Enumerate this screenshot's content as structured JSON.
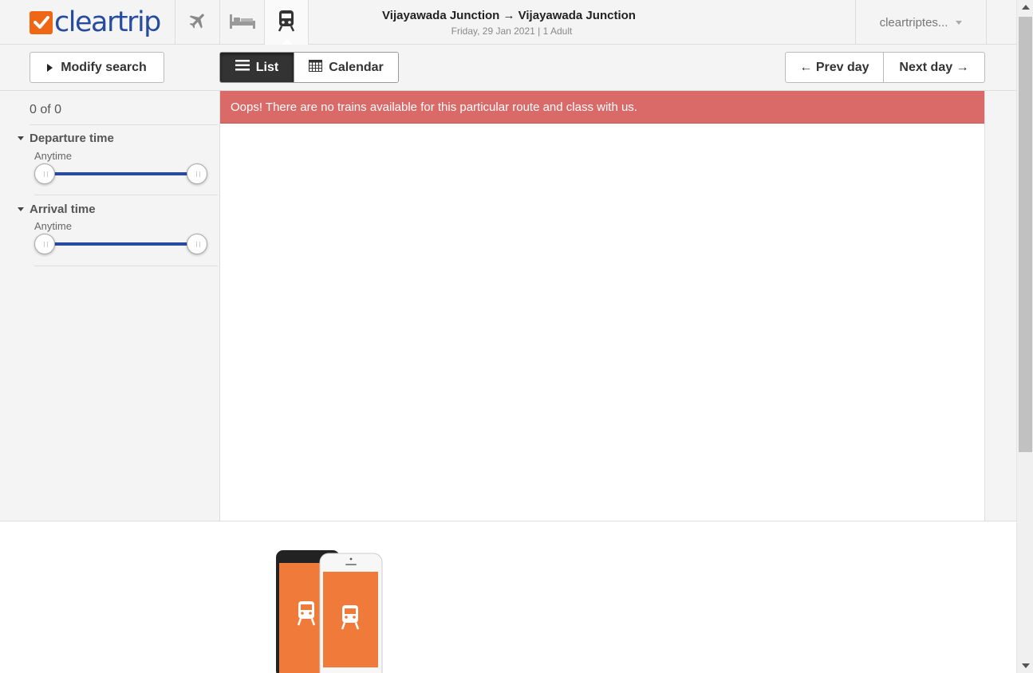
{
  "brand": {
    "name": "cleartrip",
    "accent": "#ef6614",
    "brand_blue": "#264ba0"
  },
  "header": {
    "modes": [
      {
        "name": "flights",
        "icon": "airplane-icon"
      },
      {
        "name": "hotels",
        "icon": "bed-icon"
      },
      {
        "name": "trains",
        "icon": "train-icon",
        "active": true
      }
    ],
    "route_title": "Vijayawada Junction → Vijayawada Junction",
    "route_subtitle": "Friday, 29 Jan 2021 | 1 Adult",
    "account_label": "cleartriptes..."
  },
  "toolbar": {
    "modify_label": "Modify search",
    "view_tabs": {
      "list": "List",
      "calendar": "Calendar",
      "active": "list"
    },
    "prev_label": "← Prev day",
    "next_label": "Next day →"
  },
  "sidebar": {
    "result_count": "0 of 0",
    "filters": [
      {
        "title": "Departure time",
        "value": "Anytime",
        "range_fraction": [
          0,
          1
        ]
      },
      {
        "title": "Arrival time",
        "value": "Anytime",
        "range_fraction": [
          0,
          1
        ]
      }
    ]
  },
  "main": {
    "alert_text": "Oops! There are no trains available for this particular route and class with us.",
    "alert_color": "#d96a67"
  }
}
